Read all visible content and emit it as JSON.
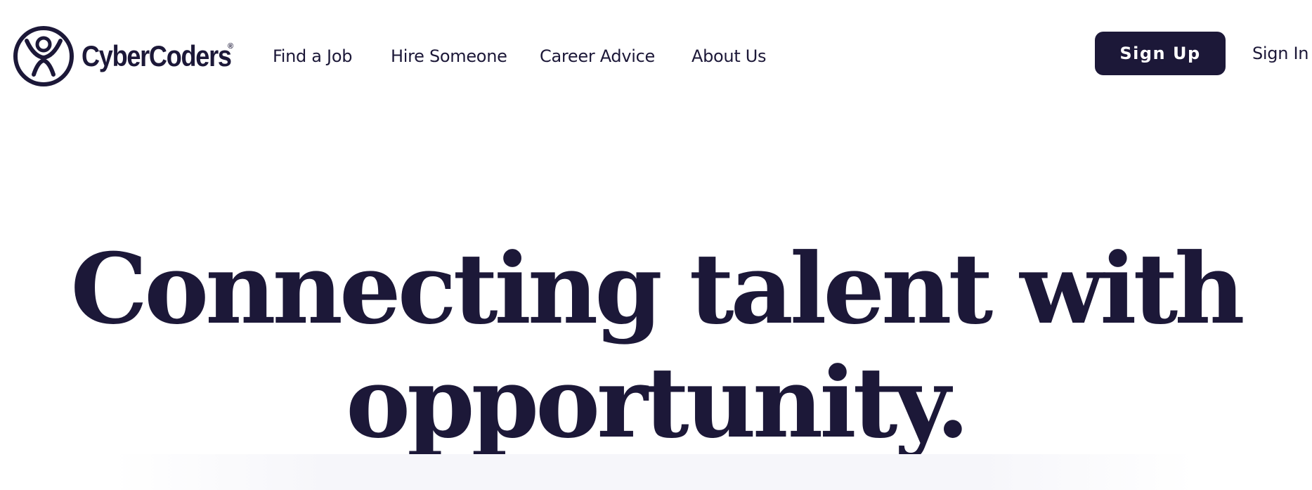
{
  "brand": {
    "name": "CyberCoders",
    "registered_mark": "®"
  },
  "nav": {
    "items": [
      {
        "label": "Find a Job"
      },
      {
        "label": "Hire Someone"
      },
      {
        "label": "Career Advice"
      },
      {
        "label": "About Us"
      }
    ]
  },
  "auth": {
    "signup_label": "Sign Up",
    "signin_label": "Sign In"
  },
  "hero": {
    "title_line1": "Connecting talent with",
    "title_line2": "opportunity."
  },
  "colors": {
    "brand_navy": "#1c1838",
    "background": "#ffffff",
    "button_text": "#ffffff"
  },
  "icons": {
    "logo": "cybercoders-person-circle-icon"
  }
}
